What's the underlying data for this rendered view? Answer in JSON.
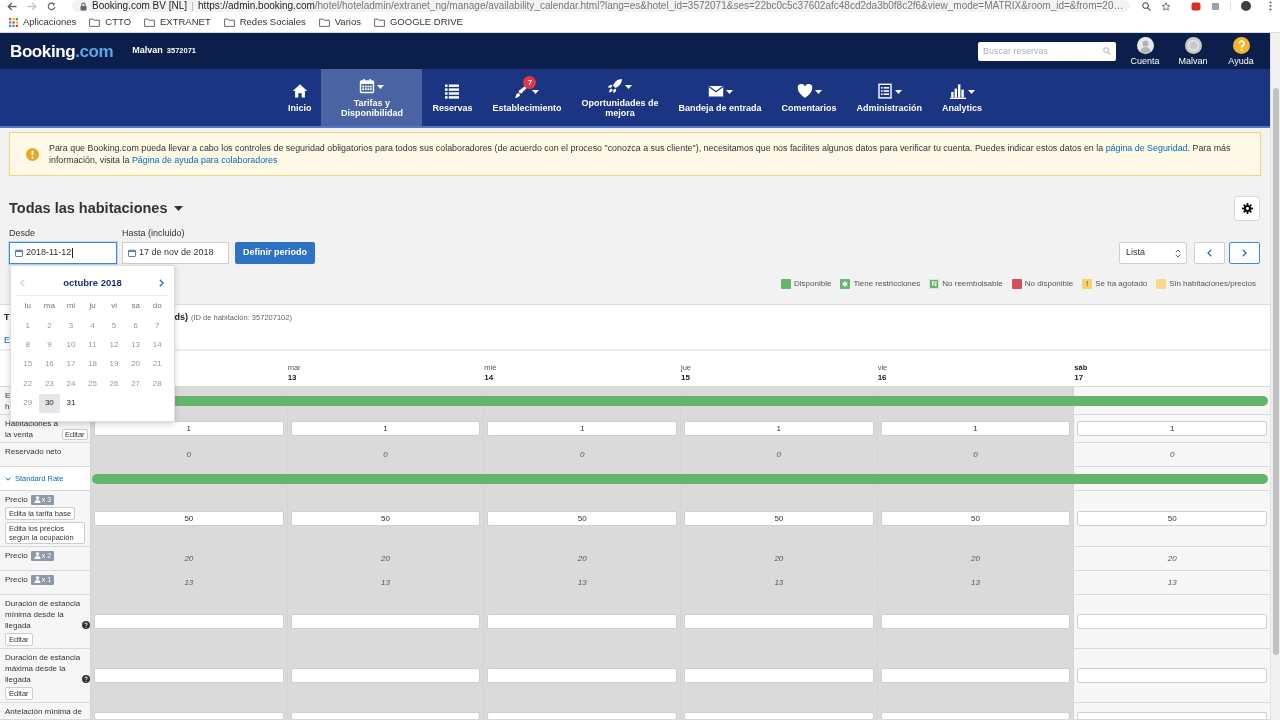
{
  "browser": {
    "site": "Booking.com BV [NL]",
    "url_host": "https://admin.booking.com",
    "url_path": "/hotel/hoteladmin/extranet_ng/manage/availability_calendar.html?lang=es&hotel_id=3572071&ses=22bc0c5c37602afc48cd2da3b0f8c2f6&view_mode=MATRIX&room_id=&from=20…"
  },
  "bookmarks": [
    {
      "label": "Aplicaciones",
      "kind": "apps"
    },
    {
      "label": "CTTO",
      "kind": "folder"
    },
    {
      "label": "EXTRANET",
      "kind": "folder"
    },
    {
      "label": "Redes Sociales",
      "kind": "folder"
    },
    {
      "label": "Varios",
      "kind": "folder"
    },
    {
      "label": "GOOGLE DRIVE",
      "kind": "folder"
    }
  ],
  "header": {
    "logo": "Booking",
    "logo_suffix": ".com",
    "property_name": "Malvan",
    "property_id": "3572071",
    "search": {
      "placeholder": "Buscar reservas"
    },
    "menus": [
      {
        "label": "Cuenta",
        "kind": "account"
      },
      {
        "label": "Malvan",
        "kind": "avatar"
      },
      {
        "label": "Ayuda",
        "kind": "help"
      }
    ]
  },
  "nav": [
    {
      "lines": [
        "Inicio"
      ],
      "kind": "home",
      "dropdown": false,
      "selected": false
    },
    {
      "lines": [
        "Tarifas y",
        "Disponibilidad"
      ],
      "kind": "calendar",
      "dropdown": true,
      "selected": true
    },
    {
      "lines": [
        "Reservas"
      ],
      "kind": "list",
      "dropdown": false,
      "selected": false
    },
    {
      "lines": [
        "Establecimiento"
      ],
      "kind": "pen",
      "dropdown": true,
      "selected": false,
      "badge": "7"
    },
    {
      "lines": [
        "Oportunidades de",
        "mejora"
      ],
      "kind": "rocket",
      "dropdown": true,
      "selected": false
    },
    {
      "lines": [
        "Bandeja de entrada"
      ],
      "kind": "envelope",
      "dropdown": true,
      "selected": false
    },
    {
      "lines": [
        "Comentarios"
      ],
      "kind": "heart",
      "dropdown": true,
      "selected": false
    },
    {
      "lines": [
        "Administración"
      ],
      "kind": "document",
      "dropdown": true,
      "selected": false
    },
    {
      "lines": [
        "Analytics"
      ],
      "kind": "chart",
      "dropdown": true,
      "selected": false
    }
  ],
  "notice": {
    "segments": [
      {
        "kind": "text",
        "text": "Para que Booking.com pueda llevar a cabo los controles de seguridad obligatorios para todos sus colaboradores (de acuerdo con el proceso \"conozca a sus cliente\"), necesitamos que nos facilites algunos datos para verificar tu cuenta. Puedes indicar estos datos en la "
      },
      {
        "kind": "link",
        "text": "página de Seguridad"
      },
      {
        "kind": "text",
        "text": ". Para más información, visita la "
      },
      {
        "kind": "link",
        "text": "Página de ayuda para colaboradores"
      }
    ]
  },
  "page_title": "Todas las habitaciones",
  "date_range": {
    "from": {
      "label": "Desde",
      "value": "2018-11-12",
      "focused": true
    },
    "to": {
      "label": "Hasta (incluido)",
      "value": "17 de nov de 2018",
      "focused": false
    },
    "button": "Definir periodo"
  },
  "view_select": {
    "value": "Lista"
  },
  "pager": [
    {
      "kind": "previous",
      "focused": false
    },
    {
      "kind": "next",
      "focused": true
    }
  ],
  "legend": [
    {
      "label": "Disponible",
      "kind": "plain",
      "color": "#66b56c"
    },
    {
      "label": "Tiene restricciones",
      "kind": "star",
      "color": "#66b56c"
    },
    {
      "label": "No reembolsable",
      "kind": "letter",
      "mark": "N",
      "color": "#66b56c"
    },
    {
      "label": "No disponible",
      "kind": "plain",
      "color": "#d2505a"
    },
    {
      "label": "Se ha agotado",
      "kind": "letter",
      "mark": "!",
      "color": "#f5d372"
    },
    {
      "label": "Sin habitaciones/precios",
      "kind": "plain",
      "color": "#f7d98b"
    }
  ],
  "date_picker": {
    "month": "octubre 2018",
    "prev_disabled": true,
    "weekdays": [
      "lu",
      "ma",
      "mi",
      "ju",
      "vi",
      "sa",
      "do"
    ],
    "weeks": [
      [
        {
          "day": "1",
          "disabled": true,
          "highlighted": false
        },
        {
          "day": "2",
          "disabled": true,
          "highlighted": false
        },
        {
          "day": "3",
          "disabled": true,
          "highlighted": false
        },
        {
          "day": "4",
          "disabled": true,
          "highlighted": false
        },
        {
          "day": "5",
          "disabled": true,
          "highlighted": false
        },
        {
          "day": "6",
          "disabled": true,
          "highlighted": false
        },
        {
          "day": "7",
          "disabled": true,
          "highlighted": false
        }
      ],
      [
        {
          "day": "8",
          "disabled": true,
          "highlighted": false
        },
        {
          "day": "9",
          "disabled": true,
          "highlighted": false
        },
        {
          "day": "10",
          "disabled": true,
          "highlighted": false
        },
        {
          "day": "11",
          "disabled": true,
          "highlighted": false
        },
        {
          "day": "12",
          "disabled": true,
          "highlighted": false
        },
        {
          "day": "13",
          "disabled": true,
          "highlighted": false
        },
        {
          "day": "14",
          "disabled": true,
          "highlighted": false
        }
      ],
      [
        {
          "day": "15",
          "disabled": true,
          "highlighted": false
        },
        {
          "day": "16",
          "disabled": true,
          "highlighted": false
        },
        {
          "day": "17",
          "disabled": true,
          "highlighted": false
        },
        {
          "day": "18",
          "disabled": true,
          "highlighted": false
        },
        {
          "day": "19",
          "disabled": true,
          "highlighted": false
        },
        {
          "day": "20",
          "disabled": true,
          "highlighted": false
        },
        {
          "day": "21",
          "disabled": true,
          "highlighted": false
        }
      ],
      [
        {
          "day": "22",
          "disabled": true,
          "highlighted": false
        },
        {
          "day": "23",
          "disabled": true,
          "highlighted": false
        },
        {
          "day": "24",
          "disabled": true,
          "highlighted": false
        },
        {
          "day": "25",
          "disabled": true,
          "highlighted": false
        },
        {
          "day": "26",
          "disabled": true,
          "highlighted": false
        },
        {
          "day": "27",
          "disabled": true,
          "highlighted": false
        },
        {
          "day": "28",
          "disabled": true,
          "highlighted": false
        }
      ],
      [
        {
          "day": "29",
          "disabled": true,
          "highlighted": false
        },
        {
          "day": "30",
          "disabled": false,
          "highlighted": true
        },
        {
          "day": "31",
          "disabled": false,
          "highlighted": false
        }
      ]
    ]
  },
  "room": {
    "title_start": "T",
    "title_end": "ds)",
    "room_id": "(ID de habitación: 357207102)",
    "link": "E"
  },
  "days": [
    {
      "weekend": false
    },
    {
      "name": "mar",
      "date": "13",
      "weekend": false
    },
    {
      "name": "mié",
      "date": "14",
      "weekend": false
    },
    {
      "name": "jue",
      "date": "15",
      "weekend": false
    },
    {
      "name": "vie",
      "date": "16",
      "weekend": false
    },
    {
      "name": "sáb",
      "date": "17",
      "weekend": true
    }
  ],
  "rows": [
    {
      "kind": "bar",
      "label_lines": [
        "E",
        "h"
      ],
      "available": true
    },
    {
      "kind": "input",
      "label": "Habitaciones a la venta",
      "button": "Editar",
      "values": [
        "1",
        "1",
        "1",
        "1",
        "1",
        "1"
      ]
    },
    {
      "kind": "text",
      "label": "Reservado neto",
      "values": [
        "0",
        "0",
        "0",
        "0",
        "0",
        "0"
      ]
    },
    {
      "kind": "rate",
      "label": "Standard Rate",
      "expanded": true,
      "available": true
    },
    {
      "kind": "input",
      "label": "Precio",
      "occupancy": "x 3",
      "buttons": [
        "Edita la tarifa base",
        "Edita los precios según la ocupación"
      ],
      "values": [
        "50",
        "50",
        "50",
        "50",
        "50",
        "50"
      ]
    },
    {
      "kind": "text",
      "label": "Precio",
      "occupancy": "x 2",
      "values": [
        "20",
        "20",
        "20",
        "20",
        "20",
        "20"
      ]
    },
    {
      "kind": "text",
      "label": "Precio",
      "occupancy": "x 1",
      "values": [
        "13",
        "13",
        "13",
        "13",
        "13",
        "13"
      ]
    },
    {
      "kind": "blank_input",
      "label": "Duración de estancia mínima desde la llegada",
      "help": true,
      "buttons": [
        "Editar"
      ]
    },
    {
      "kind": "blank_input",
      "label": "Duración de estancia máxima desde la llegada",
      "help": true,
      "buttons": [
        "Editar"
      ]
    },
    {
      "kind": "blank_input",
      "label": "Antelación mínima de"
    }
  ]
}
